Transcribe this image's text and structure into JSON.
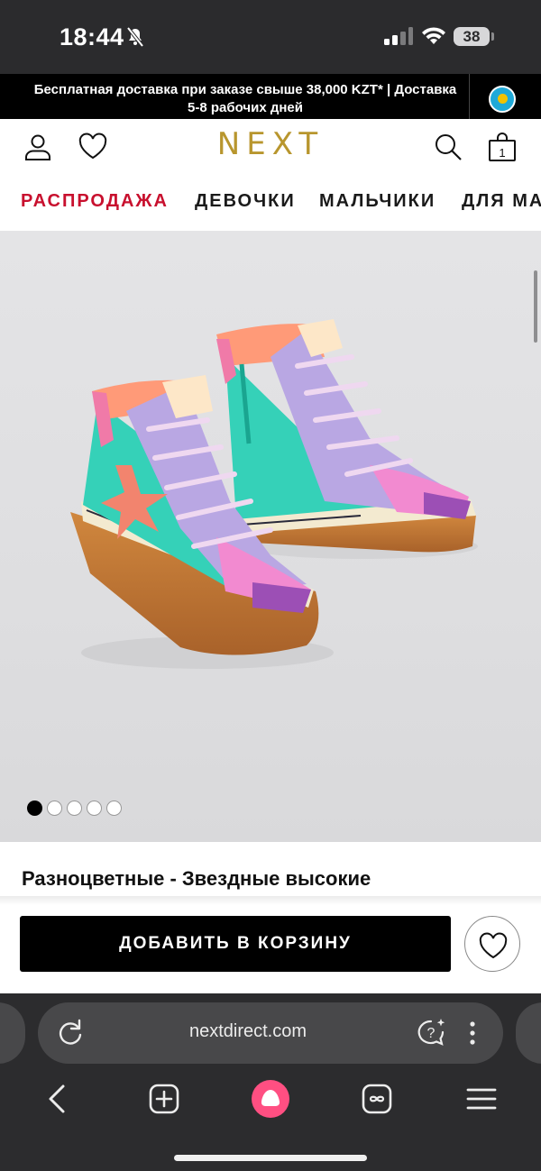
{
  "status_bar": {
    "time": "18:44",
    "battery": "38",
    "icons": [
      "mute-icon",
      "signal-icon",
      "wifi-icon",
      "battery-icon"
    ]
  },
  "promo": {
    "text": "Бесплатная доставка при заказе свыше 38,000 KZT* | Доставка 5-8 рабочих дней",
    "flag": "kazakhstan-flag-icon"
  },
  "header": {
    "logo": "NEXT",
    "icons": [
      "account-icon",
      "heart-icon",
      "search-icon",
      "bag-icon"
    ],
    "bag_count": "1",
    "brand_color": "#b8962e"
  },
  "nav": {
    "items": [
      {
        "label": "РАСПРОДАЖА",
        "accent": "#c8102e"
      },
      {
        "label": "ДЕВОЧКИ"
      },
      {
        "label": "МАЛЬЧИКИ"
      },
      {
        "label": "ДЛЯ МА"
      }
    ]
  },
  "product": {
    "image": "multicolour-star-high-top-shoes",
    "carousel": {
      "total": 5,
      "active_index": 0
    },
    "title": "Разноцветные - Звездные высокие",
    "add_to_cart_label": "ДОБАВИТЬ В КОРЗИНУ"
  },
  "browser": {
    "url": "nextdirect.com",
    "toolbar": [
      "back-icon",
      "new-tab-icon",
      "alice-assistant-icon",
      "tabs-icon",
      "menu-icon"
    ],
    "address_icons": [
      "reload-icon",
      "ai-chat-icon",
      "more-icon"
    ]
  }
}
